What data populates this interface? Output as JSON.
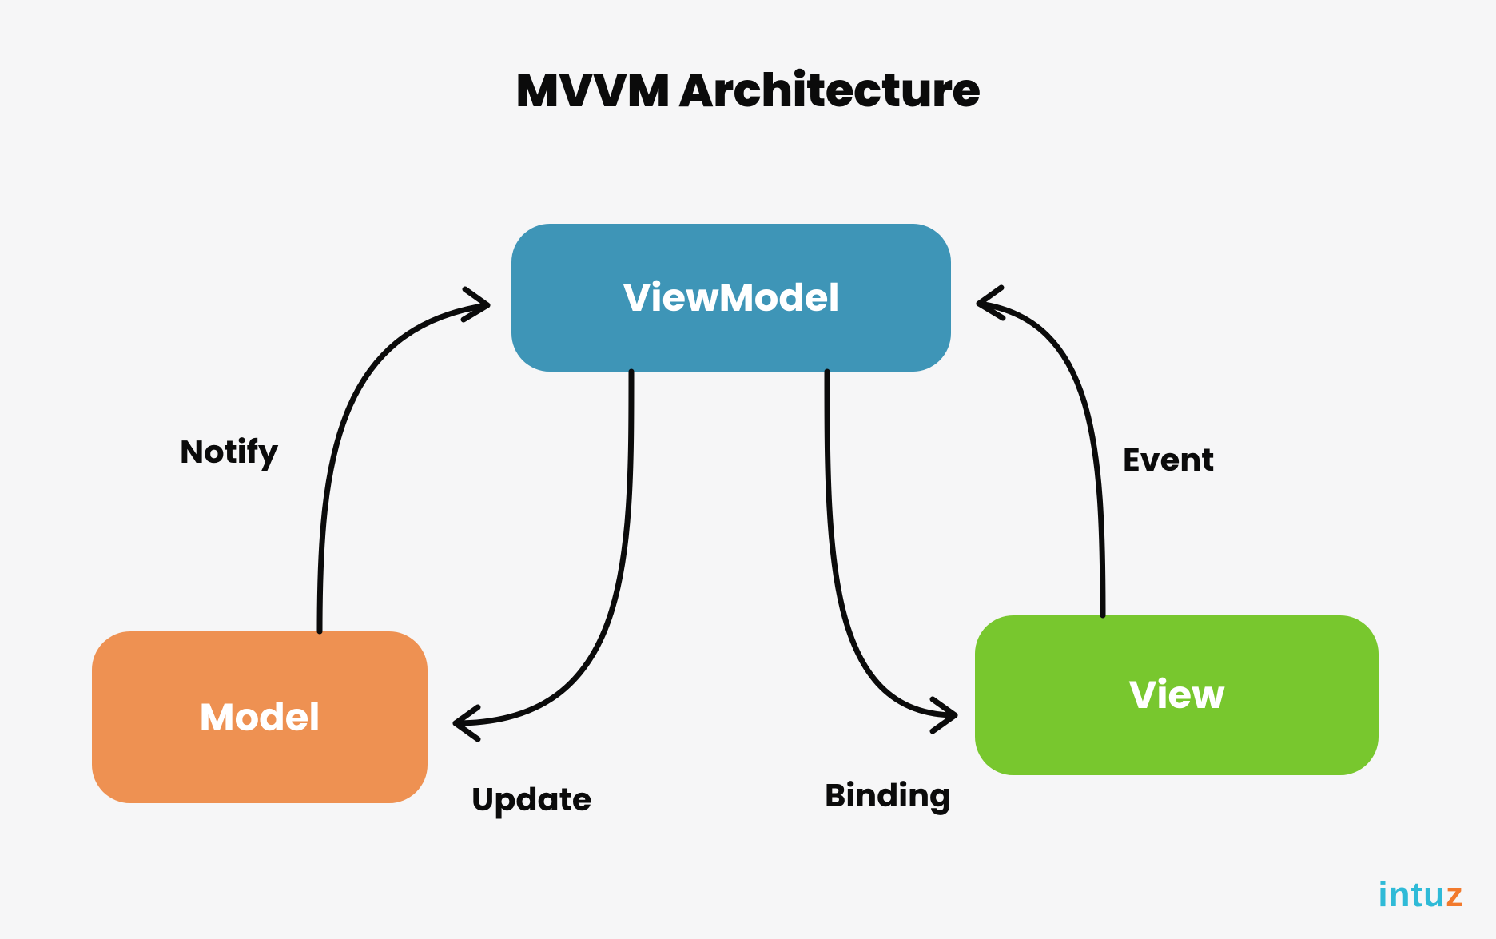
{
  "title": "MVVM Architecture",
  "nodes": {
    "viewmodel": "ViewModel",
    "model": "Model",
    "view": "View"
  },
  "edges": {
    "notify": {
      "label": "Notify",
      "from": "Model",
      "to": "ViewModel"
    },
    "update": {
      "label": "Update",
      "from": "ViewModel",
      "to": "Model"
    },
    "binding": {
      "label": "Binding",
      "from": "ViewModel",
      "to": "View"
    },
    "event": {
      "label": "Event",
      "from": "View",
      "to": "ViewModel"
    }
  },
  "logo": {
    "part1": "InTU",
    "part2": "Z"
  },
  "colors": {
    "viewmodel": "#3e95b7",
    "model": "#ee9152",
    "view": "#78c72e",
    "arrow": "#0b0b0b",
    "text": "#0b0b0b",
    "background": "#f6f6f7",
    "logo_primary": "#2fbad7",
    "logo_accent": "#f27a2d"
  }
}
